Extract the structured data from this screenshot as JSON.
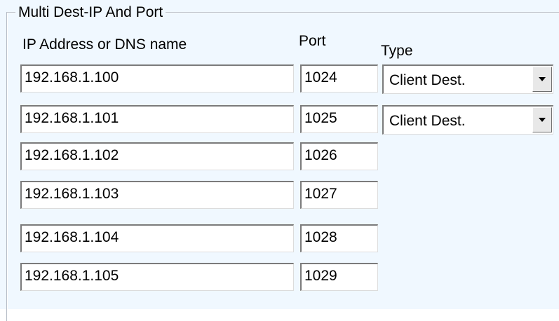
{
  "group": {
    "title": "Multi Dest-IP And Port"
  },
  "columns": {
    "ip": "IP Address or DNS name",
    "port": "Port",
    "type": "Type"
  },
  "rows": [
    {
      "ip": "192.168.1.100",
      "port": "1024",
      "type": "Client Dest."
    },
    {
      "ip": "192.168.1.101",
      "port": "1025",
      "type": "Client Dest."
    },
    {
      "ip": "192.168.1.102",
      "port": "1026"
    },
    {
      "ip": "192.168.1.103",
      "port": "1027"
    },
    {
      "ip": "192.168.1.104",
      "port": "1028"
    },
    {
      "ip": "192.168.1.105",
      "port": "1029"
    }
  ],
  "icons": {
    "dropdown": "chevron-down-icon"
  },
  "colors": {
    "panel_background": "#f0f8ff",
    "field_background": "#ffffff",
    "field_border_dark": "#7b7b7b",
    "button_face": "#e8e8e8"
  }
}
